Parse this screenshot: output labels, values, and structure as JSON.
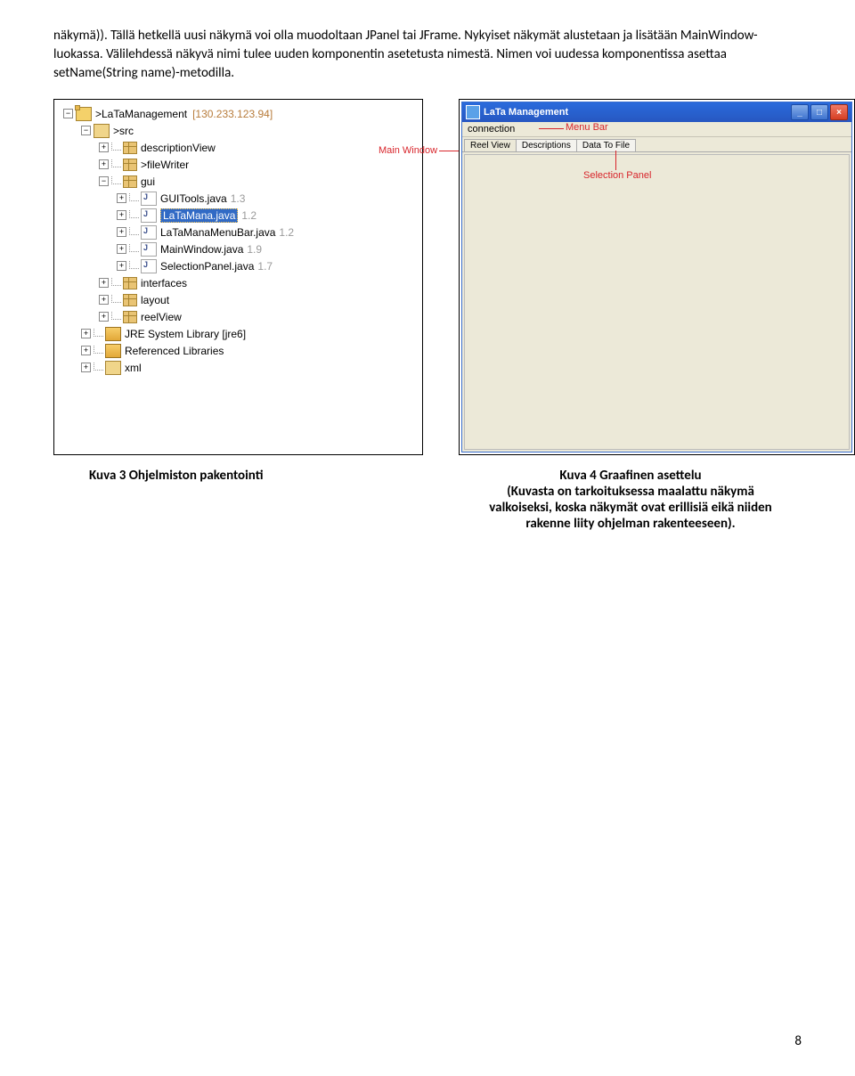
{
  "paragraph": "näkymä)). Tällä hetkellä uusi näkymä voi olla muodoltaan JPanel tai JFrame. Nykyiset näkymät alustetaan ja lisätään MainWindow-luokassa. Välilehdessä näkyvä nimi tulee uuden komponentin asetetusta nimestä. Nimen voi uudessa komponentissa asettaa setName(String name)-metodilla.",
  "tree": {
    "root": ">LaTaManagement",
    "root_ip": "[130.233.123.94]",
    "src": ">src",
    "pkgs": {
      "descriptionView": "descriptionView",
      "fileWriter": ">fileWriter",
      "gui": "gui",
      "interfaces": "interfaces",
      "layout": "layout",
      "reelView": "reelView"
    },
    "javas": {
      "guitools": {
        "name": "GUITools.java",
        "ver": "1.3"
      },
      "latamana": {
        "name": "LaTaMana.java",
        "ver": "1.2"
      },
      "menubar": {
        "name": "LaTaManaMenuBar.java",
        "ver": "1.2"
      },
      "mainwindow": {
        "name": "MainWindow.java",
        "ver": "1.9"
      },
      "selpanel": {
        "name": "SelectionPanel.java",
        "ver": "1.7"
      }
    },
    "jre": "JRE System Library [jre6]",
    "reflibs": "Referenced Libraries",
    "xml": "xml"
  },
  "labels": {
    "mainwindow": "Main Window",
    "menubar": "Menu Bar",
    "selpanel": "Selection Panel"
  },
  "app": {
    "title": "LaTa Management",
    "menu": "connection",
    "tabs": [
      "Reel View",
      "Descriptions",
      "Data To File"
    ]
  },
  "captions": {
    "left": "Kuva 3 Ohjelmiston pakentointi",
    "right_title": "Kuva 4 Graafinen asettelu",
    "right_body": "(Kuvasta on tarkoituksessa maalattu näkymä valkoiseksi, koska näkymät ovat erillisiä eikä niiden rakenne liity ohjelman rakenteeseen)."
  },
  "pagenum": "8",
  "exp_plus": "+",
  "exp_minus": "−"
}
